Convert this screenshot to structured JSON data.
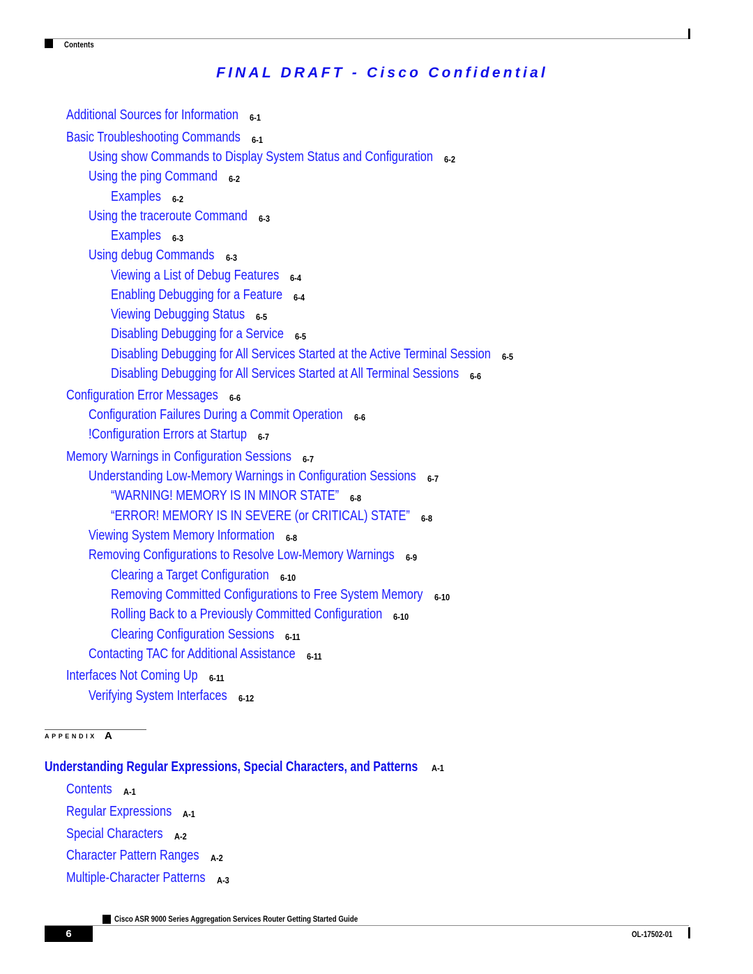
{
  "header": {
    "section_label": "Contents",
    "watermark": "FINAL DRAFT - Cisco Confidential"
  },
  "colors": {
    "link": "#1a1aff",
    "watermark": "#1010e8",
    "page_number": "#000000"
  },
  "toc": [
    {
      "level": 1,
      "title": "Additional Sources for Information",
      "page": "6-1"
    },
    {
      "level": 1,
      "title": "Basic Troubleshooting Commands",
      "page": "6-1"
    },
    {
      "level": 2,
      "title": "Using show Commands to Display System Status and Configuration",
      "page": "6-2"
    },
    {
      "level": 2,
      "title": "Using the ping Command",
      "page": "6-2"
    },
    {
      "level": 3,
      "title": "Examples",
      "page": "6-2"
    },
    {
      "level": 2,
      "title": "Using the traceroute Command",
      "page": "6-3"
    },
    {
      "level": 3,
      "title": "Examples",
      "page": "6-3"
    },
    {
      "level": 2,
      "title": "Using debug Commands",
      "page": "6-3"
    },
    {
      "level": 3,
      "title": "Viewing a List of Debug Features",
      "page": "6-4"
    },
    {
      "level": 3,
      "title": "Enabling Debugging for a Feature",
      "page": "6-4"
    },
    {
      "level": 3,
      "title": "Viewing Debugging Status",
      "page": "6-5"
    },
    {
      "level": 3,
      "title": "Disabling Debugging for a Service",
      "page": "6-5"
    },
    {
      "level": 3,
      "title": "Disabling Debugging for All Services Started at the Active Terminal Session",
      "page": "6-5"
    },
    {
      "level": 3,
      "title": "Disabling Debugging for All Services Started at All Terminal Sessions",
      "page": "6-6"
    },
    {
      "level": 1,
      "title": "Configuration Error Messages",
      "page": "6-6"
    },
    {
      "level": 2,
      "title": "Configuration Failures During a Commit Operation",
      "page": "6-6"
    },
    {
      "level": 2,
      "title": "!Configuration Errors at Startup",
      "page": "6-7"
    },
    {
      "level": 1,
      "title": "Memory Warnings in Configuration Sessions",
      "page": "6-7"
    },
    {
      "level": 2,
      "title": "Understanding Low-Memory Warnings in Configuration Sessions",
      "page": "6-7"
    },
    {
      "level": 3,
      "title": "“WARNING! MEMORY IS IN MINOR STATE”",
      "page": "6-8"
    },
    {
      "level": 3,
      "title": "“ERROR! MEMORY IS IN SEVERE (or CRITICAL) STATE”",
      "page": "6-8"
    },
    {
      "level": 2,
      "title": "Viewing System Memory Information",
      "page": "6-8"
    },
    {
      "level": 2,
      "title": "Removing Configurations to Resolve Low-Memory Warnings",
      "page": "6-9"
    },
    {
      "level": 3,
      "title": "Clearing a Target Configuration",
      "page": "6-10"
    },
    {
      "level": 3,
      "title": "Removing Committed Configurations to Free System Memory",
      "page": "6-10"
    },
    {
      "level": 3,
      "title": "Rolling Back to a Previously Committed Configuration",
      "page": "6-10"
    },
    {
      "level": 3,
      "title": "Clearing Configuration Sessions",
      "page": "6-11"
    },
    {
      "level": 2,
      "title": "Contacting TAC for Additional Assistance",
      "page": "6-11"
    },
    {
      "level": 1,
      "title": "Interfaces Not Coming Up",
      "page": "6-11"
    },
    {
      "level": 2,
      "title": "Verifying System Interfaces",
      "page": "6-12"
    }
  ],
  "appendix": {
    "label": "APPENDIX",
    "letter": "A",
    "chapter_title": "Understanding Regular Expressions, Special Characters, and Patterns",
    "chapter_page": "A-1",
    "entries": [
      {
        "level": 1,
        "title": "Contents",
        "page": "A-1"
      },
      {
        "level": 1,
        "title": "Regular Expressions",
        "page": "A-1"
      },
      {
        "level": 1,
        "title": "Special Characters",
        "page": "A-2"
      },
      {
        "level": 1,
        "title": "Character Pattern Ranges",
        "page": "A-2"
      },
      {
        "level": 1,
        "title": "Multiple-Character Patterns",
        "page": "A-3"
      }
    ]
  },
  "footer": {
    "book_title": "Cisco ASR 9000 Series Aggregation Services Router Getting Started Guide",
    "page_number": "6",
    "doc_number": "OL-17502-01"
  }
}
